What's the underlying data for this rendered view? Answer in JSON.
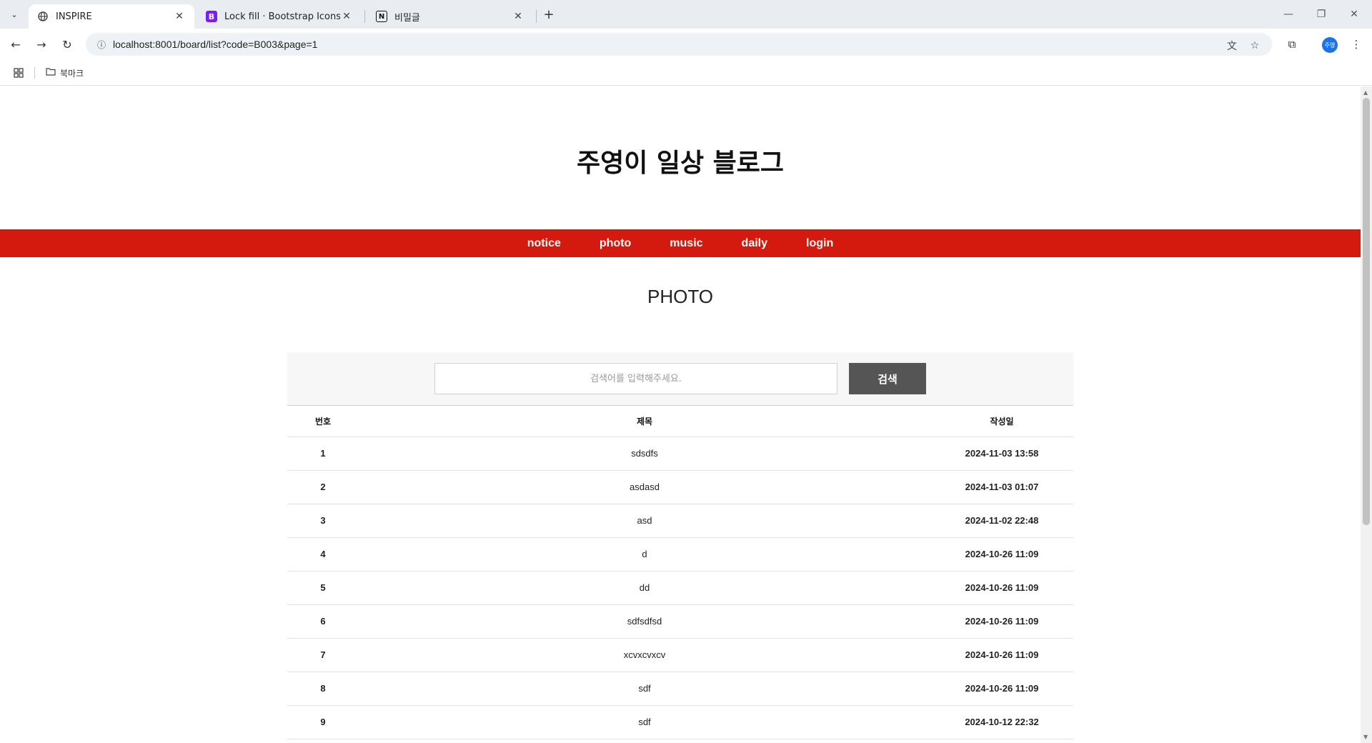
{
  "browser": {
    "tabs": [
      {
        "title": "INSPIRE",
        "favicon": "globe-icon",
        "active": true
      },
      {
        "title": "Lock fill · Bootstrap Icons",
        "favicon": "bootstrap-icon",
        "favicon_text": "B",
        "active": false
      },
      {
        "title": "비밀글",
        "favicon": "notion-icon",
        "favicon_text": "N",
        "active": false
      }
    ],
    "url": "localhost:8001/board/list?code=B003&page=1",
    "profile_label": "주영",
    "bookmarks": [
      {
        "label": "북마크",
        "icon": "folder-icon"
      }
    ]
  },
  "page": {
    "blog_title": "주영이 일상 블로그",
    "nav": [
      "notice",
      "photo",
      "music",
      "daily",
      "login"
    ],
    "section_title": "PHOTO",
    "search": {
      "placeholder": "검색어를 입력해주세요.",
      "button_label": "검색"
    },
    "table": {
      "headers": [
        "번호",
        "제목",
        "작성일"
      ],
      "rows": [
        {
          "no": "1",
          "title": "sdsdfs",
          "date": "2024-11-03 13:58"
        },
        {
          "no": "2",
          "title": "asdasd",
          "date": "2024-11-03 01:07"
        },
        {
          "no": "3",
          "title": "asd",
          "date": "2024-11-02 22:48"
        },
        {
          "no": "4",
          "title": "d",
          "date": "2024-10-26 11:09"
        },
        {
          "no": "5",
          "title": "dd",
          "date": "2024-10-26 11:09"
        },
        {
          "no": "6",
          "title": "sdfsdfsd",
          "date": "2024-10-26 11:09"
        },
        {
          "no": "7",
          "title": "xcvxcvxcv",
          "date": "2024-10-26 11:09"
        },
        {
          "no": "8",
          "title": "sdf",
          "date": "2024-10-26 11:09"
        },
        {
          "no": "9",
          "title": "sdf",
          "date": "2024-10-12 22:32"
        }
      ]
    }
  },
  "colors": {
    "nav_bar": "#d4190e",
    "search_button": "#555555",
    "tab_strip": "#e9edf2"
  }
}
